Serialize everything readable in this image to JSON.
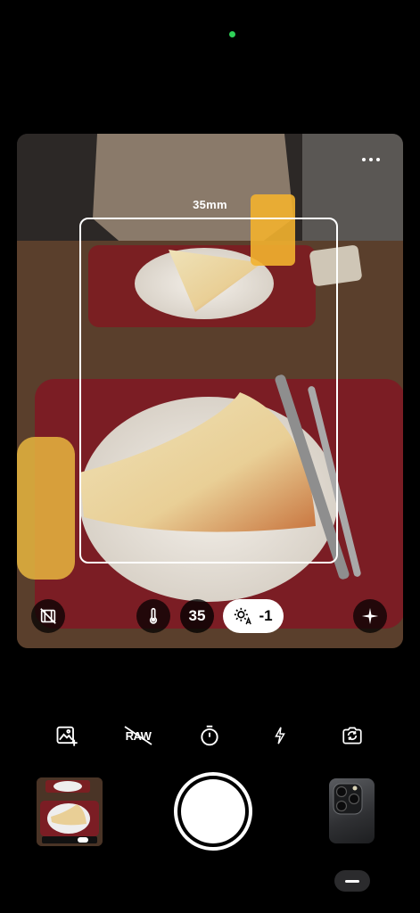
{
  "viewfinder": {
    "focal_length_label": "35mm",
    "lens_button_label": "35",
    "exposure_value": "-1"
  },
  "toolbar": {
    "raw_label": "RAW"
  },
  "colors": {
    "status_dot": "#2fd158",
    "background": "#000000",
    "ev_pill_bg": "#ffffff"
  },
  "icons": [
    "more-dots-icon",
    "film-off-icon",
    "thermometer-icon",
    "exposure-auto-icon",
    "sparkle-icon",
    "add-photo-icon",
    "raw-off-icon",
    "timer-icon",
    "flash-icon",
    "switch-camera-icon"
  ]
}
